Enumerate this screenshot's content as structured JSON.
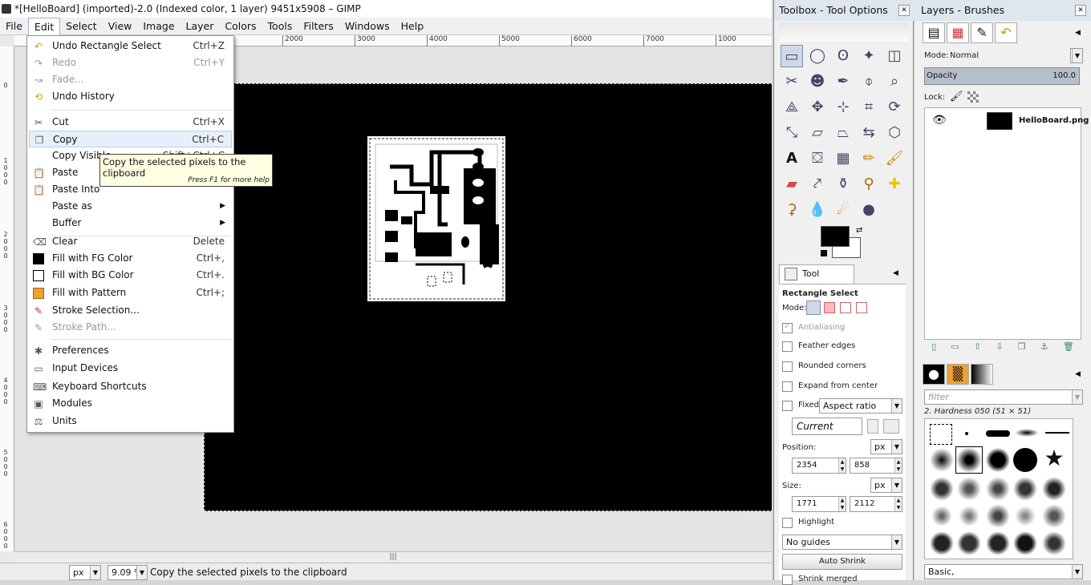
{
  "window": {
    "title": "*[HelloBoard] (imported)-2.0 (Indexed color, 1 layer) 9451x5908 – GIMP"
  },
  "menubar": [
    "File",
    "Edit",
    "Select",
    "View",
    "Image",
    "Layer",
    "Colors",
    "Tools",
    "Filters",
    "Windows",
    "Help"
  ],
  "rulers": {
    "h": [
      "1000",
      "2000",
      "3000",
      "4000",
      "5000",
      "6000",
      "7000"
    ],
    "v": [
      "0",
      "1",
      "0",
      "0",
      "0",
      "2",
      "0",
      "0",
      "0",
      "3",
      "0",
      "0",
      "0",
      "4",
      "0",
      "0",
      "0",
      "5",
      "0",
      "0",
      "0",
      "6",
      "0",
      "0",
      "0"
    ]
  },
  "edit_menu": {
    "undo": {
      "label": "Undo Rectangle Select",
      "shortcut": "Ctrl+Z"
    },
    "redo": {
      "label": "Redo",
      "shortcut": "Ctrl+Y"
    },
    "fade": {
      "label": "Fade...",
      "shortcut": ""
    },
    "undo_history": {
      "label": "Undo History",
      "shortcut": ""
    },
    "cut": {
      "label": "Cut",
      "shortcut": "Ctrl+X"
    },
    "copy": {
      "label": "Copy",
      "shortcut": "Ctrl+C"
    },
    "copy_visible": {
      "label": "Copy Visible",
      "shortcut": "Shift+Ctrl+C"
    },
    "paste": {
      "label": "Paste",
      "shortcut": ""
    },
    "paste_into": {
      "label": "Paste Into",
      "shortcut": ""
    },
    "paste_as": {
      "label": "Paste as",
      "shortcut": ""
    },
    "buffer": {
      "label": "Buffer",
      "shortcut": ""
    },
    "clear": {
      "label": "Clear",
      "shortcut": "Delete"
    },
    "fill_fg": {
      "label": "Fill with FG Color",
      "shortcut": "Ctrl+,"
    },
    "fill_bg": {
      "label": "Fill with BG Color",
      "shortcut": "Ctrl+."
    },
    "fill_pattern": {
      "label": "Fill with Pattern",
      "shortcut": "Ctrl+;"
    },
    "stroke_selection": {
      "label": "Stroke Selection...",
      "shortcut": ""
    },
    "stroke_path": {
      "label": "Stroke Path...",
      "shortcut": ""
    },
    "preferences": {
      "label": "Preferences",
      "shortcut": ""
    },
    "input_devices": {
      "label": "Input Devices",
      "shortcut": ""
    },
    "keyboard_shortcuts": {
      "label": "Keyboard Shortcuts",
      "shortcut": ""
    },
    "modules": {
      "label": "Modules",
      "shortcut": ""
    },
    "units": {
      "label": "Units",
      "shortcut": ""
    }
  },
  "tooltip": {
    "text": "Copy the selected pixels to the clipboard",
    "hint": "Press F1 for more help"
  },
  "statusbar": {
    "unit": "px",
    "zoom": "9.09 %",
    "message": "Copy the selected pixels to the clipboard"
  },
  "toolbox": {
    "title": "Toolbox - Tool Options",
    "tab": "Tool Options",
    "tool_name": "Rectangle Select",
    "mode_label": "Mode:",
    "antialiasing": "Antialiasing",
    "feather_edges": "Feather edges",
    "rounded_corners": "Rounded corners",
    "expand_from_center": "Expand from center",
    "fixed_label": "Fixed:",
    "fixed_value": "Aspect ratio",
    "current": "Current",
    "position_label": "Position:",
    "pos_unit": "px",
    "pos_x": "2354",
    "pos_y": "858",
    "size_label": "Size:",
    "size_unit": "px",
    "size_w": "1771",
    "size_h": "2112",
    "highlight": "Highlight",
    "guides": "No guides",
    "auto_shrink": "Auto Shrink",
    "shrink_merged": "Shrink merged"
  },
  "layers": {
    "title": "Layers - Brushes",
    "mode_label": "Mode:",
    "mode_value": "Normal",
    "opacity_label": "Opacity",
    "opacity_value": "100.0",
    "lock_label": "Lock:",
    "layer_name": "HelloBoard.png",
    "filter_placeholder": "filter",
    "brush_name": "2. Hardness 050 (51 × 51)",
    "preset": "Basic,"
  },
  "colors": {
    "fg": "#000000",
    "bg": "#ffffff",
    "accent": "#cfd9e6"
  }
}
